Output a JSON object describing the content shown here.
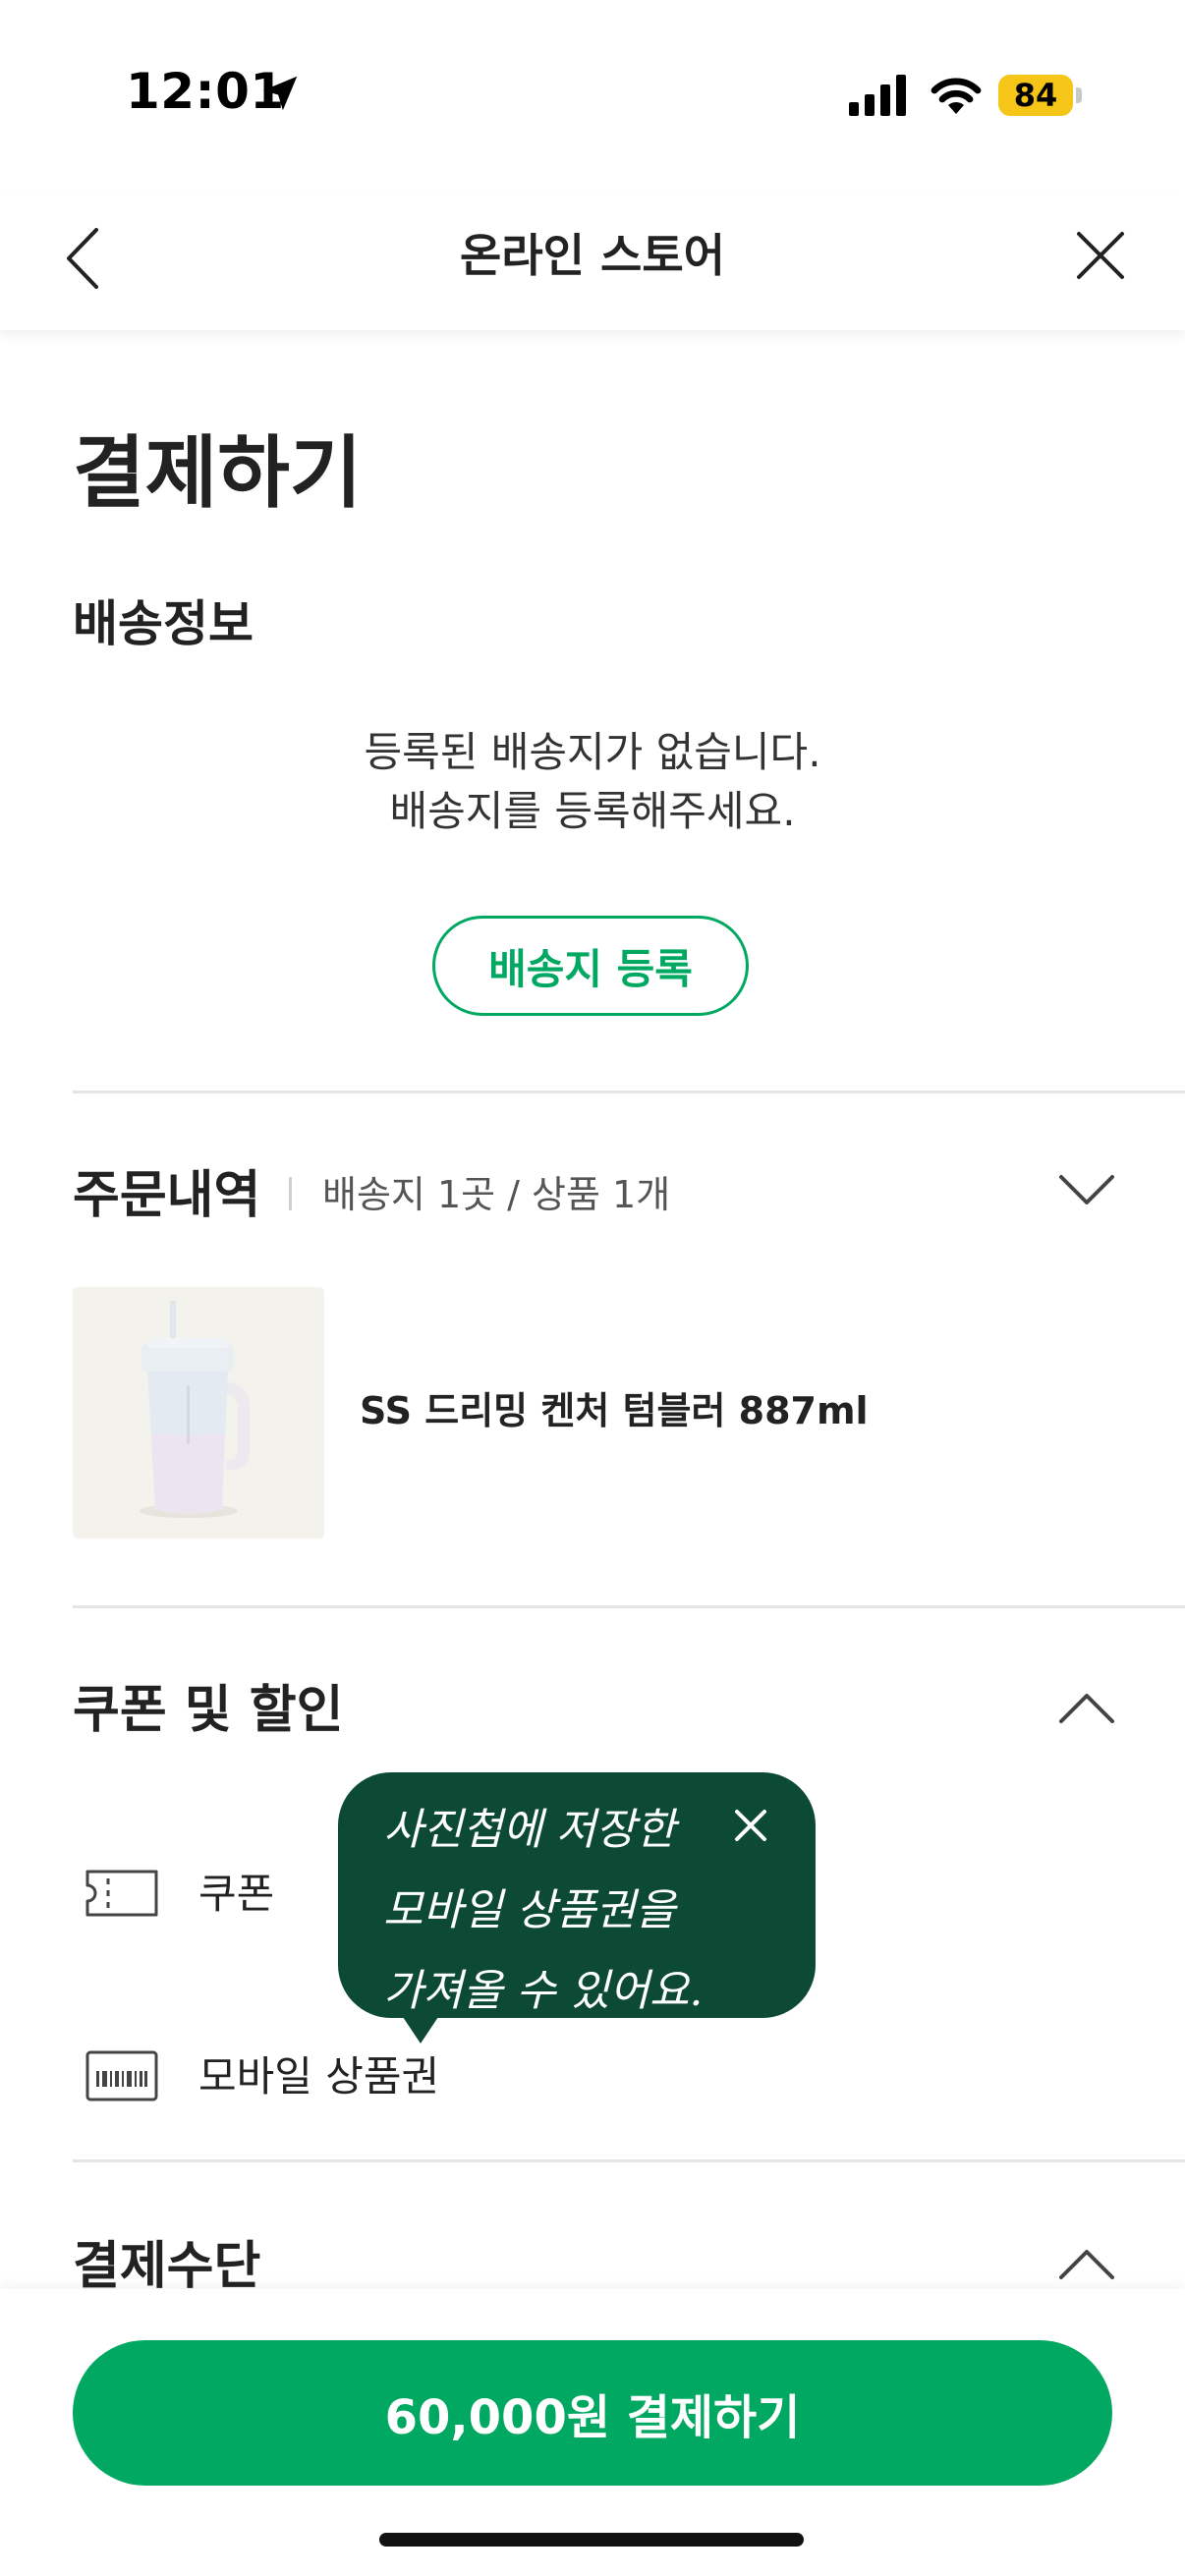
{
  "status_bar": {
    "time": "12:01",
    "battery": "84"
  },
  "header": {
    "title": "온라인 스토어"
  },
  "page": {
    "title": "결제하기"
  },
  "shipping": {
    "title": "배송정보",
    "empty_line1": "등록된 배송지가 없습니다.",
    "empty_line2": "배송지를 등록해주세요.",
    "register_button": "배송지 등록"
  },
  "orders": {
    "title": "주문내역",
    "summary": "배송지 1곳 / 상품 1개",
    "items": [
      {
        "name": "SS 드리밍 켄처 텀블러 887ml"
      }
    ]
  },
  "discount": {
    "title": "쿠폰 및 할인",
    "coupon_label": "쿠폰",
    "giftcard_label": "모바일 상품권"
  },
  "tooltip": {
    "line1": "사진첩에 저장한",
    "line2": "모바일 상품권을",
    "line3": "가져올 수 있어요."
  },
  "payment": {
    "title": "결제수단"
  },
  "pay_button": {
    "label": "60,000원 결제하기"
  },
  "colors": {
    "accent": "#00a862",
    "tooltip": "#0d4a36",
    "battery": "#f5c518"
  }
}
